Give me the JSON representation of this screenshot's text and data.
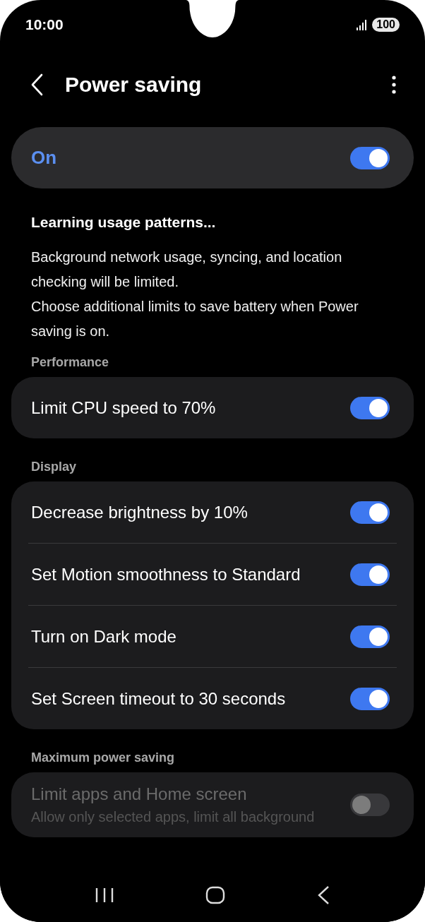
{
  "status_bar": {
    "time": "10:00",
    "battery": "100"
  },
  "header": {
    "title": "Power saving"
  },
  "master": {
    "label": "On",
    "on": true
  },
  "status_title": "Learning usage patterns...",
  "description": [
    "Background network usage, syncing, and location checking will be limited.",
    "Choose additional limits to save battery when Power saving is on."
  ],
  "sections": [
    {
      "title": "Performance",
      "items": [
        {
          "label": "Limit CPU speed to 70%",
          "on": true,
          "disabled": false
        }
      ]
    },
    {
      "title": "Display",
      "items": [
        {
          "label": "Decrease brightness by 10%",
          "on": true,
          "disabled": false
        },
        {
          "label": "Set Motion smoothness to Standard",
          "on": true,
          "disabled": false
        },
        {
          "label": "Turn on Dark mode",
          "on": true,
          "disabled": false
        },
        {
          "label": "Set Screen timeout to 30 seconds",
          "on": true,
          "disabled": false
        }
      ]
    },
    {
      "title": "Maximum power saving",
      "items": [
        {
          "label": "Limit apps and Home screen",
          "sublabel": "Allow only selected apps, limit all background",
          "on": false,
          "disabled": true
        }
      ]
    }
  ]
}
